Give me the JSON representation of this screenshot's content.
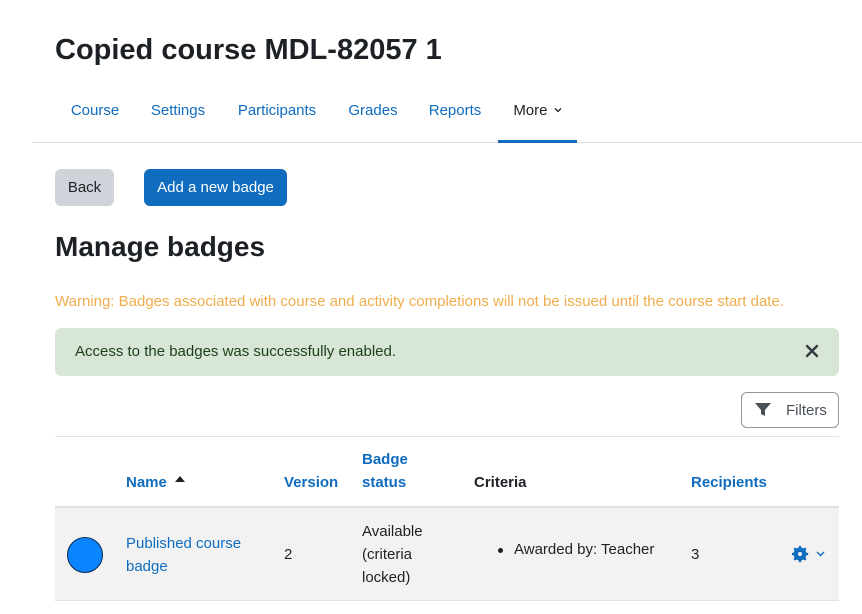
{
  "course": {
    "title": "Copied course MDL-82057 1"
  },
  "nav": {
    "items": [
      "Course",
      "Settings",
      "Participants",
      "Grades",
      "Reports"
    ],
    "more_label": "More"
  },
  "buttons": {
    "back": "Back",
    "add_badge": "Add a new badge"
  },
  "page": {
    "heading": "Manage badges"
  },
  "warning": "Warning: Badges associated with course and activity completions will not be issued until the course start date.",
  "alert": {
    "message": "Access to the badges was successfully enabled."
  },
  "filters": {
    "label": "Filters"
  },
  "table": {
    "headers": {
      "name": "Name",
      "version": "Version",
      "status_line1": "Badge",
      "status_line2": "status",
      "criteria": "Criteria",
      "recipients": "Recipients"
    },
    "rows": [
      {
        "name_line1": "Published course",
        "name_line2": "badge",
        "version": "2",
        "status_line1": "Available",
        "status_line2": "(criteria",
        "status_line3": "locked)",
        "criteria": "Awarded by: Teacher",
        "recipients": "3"
      }
    ]
  },
  "colors": {
    "primary": "#0f6cbf",
    "warning": "#f0ad4e",
    "success_bg": "#d7e6d6",
    "badge_fill": "#0a84ff"
  },
  "icons": {
    "more": "chevron-down-icon",
    "alert_close": "close-icon",
    "filters": "filter-icon",
    "sort": "sort-asc-icon",
    "actions": "gear-icon"
  }
}
